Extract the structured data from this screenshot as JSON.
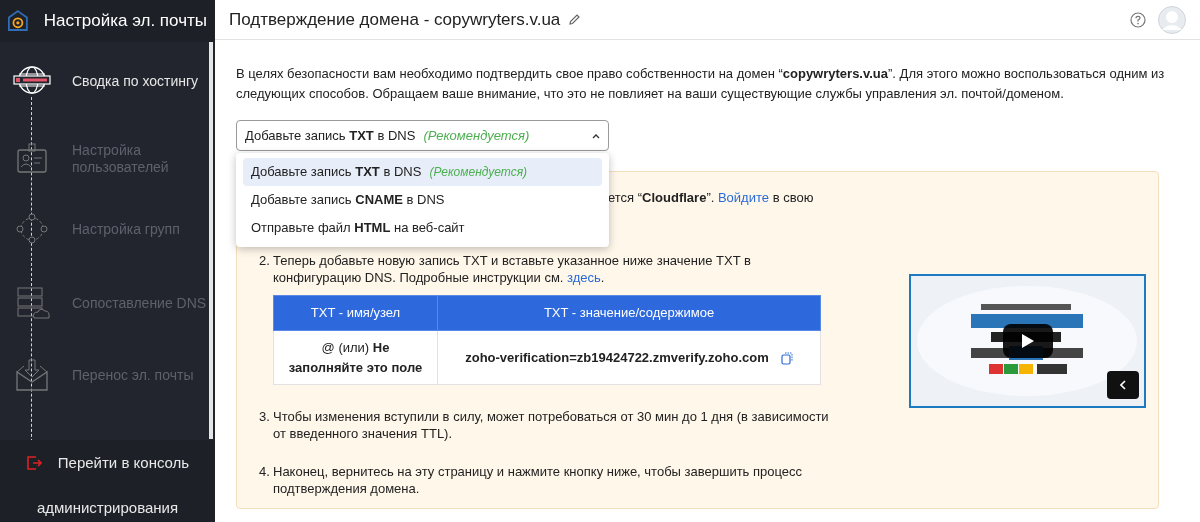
{
  "sidebar": {
    "title": "Настройка эл. почты",
    "steps": [
      {
        "label": "Сводка по хостингу",
        "kind": "globe",
        "active": true
      },
      {
        "label": "Настройка пользователей",
        "kind": "idcard",
        "active": false
      },
      {
        "label": "Настройка групп",
        "kind": "group",
        "active": false
      },
      {
        "label": "Сопоставление DNS",
        "kind": "server",
        "active": false
      },
      {
        "label": "Перенос эл. почты",
        "kind": "inbox",
        "active": false
      }
    ],
    "footer": [
      "Перейти в консоль",
      "администрирования"
    ]
  },
  "header": {
    "title": "Подтверждение домена - copywryters.v.ua"
  },
  "intro": "В целях безопасности вам необходимо подтвердить свое право собственности на домен “**copywryters.v.ua**”. Для этого можно воспользоваться одним из следующих способов. Обращаем ваше внимание, что это не повлияет на ваши существующие службы управления эл. почтой/доменом.",
  "method_select": {
    "value": "Добавьте запись **TXT** в DNS",
    "value_note": "(Рекомендуется)",
    "expanded": true,
    "options": [
      {
        "label": "Добавьте запись **TXT** в DNS",
        "note": "(Рекомендуется)",
        "selected": true
      },
      {
        "label": "Добавьте запись **CNAME** в DNS",
        "selected": false
      },
      {
        "label": "Отправьте файл **HTML** на веб-сайт",
        "selected": false
      }
    ]
  },
  "steps": [
    {
      "text": "ется “**Cloudflare**”. ",
      "link": "Войдите",
      "after": " в свою"
    },
    {
      "number": "2.",
      "text": "Теперь добавьте новую запись TXT и вставьте указанное ниже значение TXT в конфигурацию DNS. Подробные инструкции см. ",
      "link": "здесь",
      "after": "."
    }
  ],
  "table": {
    "columns": [
      "TXT - имя/узел",
      "TXT - значение/содержимое"
    ],
    "rows": [
      [
        "@ (или) **Не заполняйте это поле**",
        "zoho-verification=zb19424722.zmverify.zoho.com"
      ]
    ]
  },
  "later_steps": [
    {
      "number": "3.",
      "text": "Чтобы изменения вступили в силу, может потребоваться от 30 мин до 1 дня (в зависимости от введенного значения TTL)."
    },
    {
      "number": "4.",
      "text": "Наконец, вернитесь на эту страницу и нажмите кнопку ниже, чтобы завершить процесс подтверждения домена."
    }
  ]
}
